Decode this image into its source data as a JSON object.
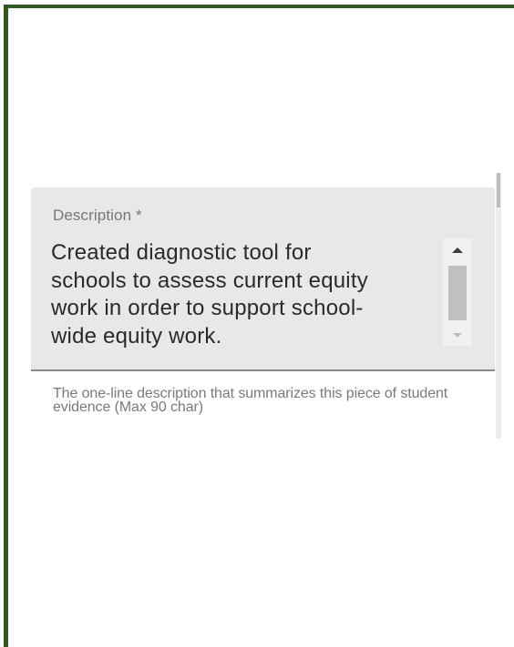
{
  "description_field": {
    "label": "Description *",
    "value": "Created diagnostic tool for\nschools to assess current equity\nwork in order to support school-\nwide equity work.",
    "helper_text": "The one-line description that summarizes this piece of student evidence (Max 90 char)"
  },
  "colors": {
    "frame_border": "#2f5a1f",
    "field_background": "#e8e8e8",
    "field_underline": "#8a8a8a"
  },
  "icons": {
    "scroll_up": "scroll-up-arrow-icon",
    "scroll_down": "scroll-down-arrow-icon"
  }
}
